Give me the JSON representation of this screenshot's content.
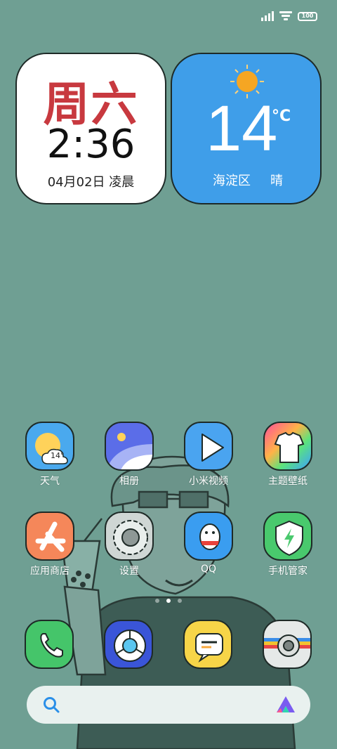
{
  "status_bar": {
    "battery": "100"
  },
  "clock_widget": {
    "day": "周六",
    "time": "2:36",
    "date": "04月02日 凌晨"
  },
  "weather_widget": {
    "temperature": "14",
    "unit": "°C",
    "location": "海淀区",
    "condition": "晴"
  },
  "apps_row1": [
    {
      "label": "天气",
      "badge": "14°"
    },
    {
      "label": "相册"
    },
    {
      "label": "小米视频"
    },
    {
      "label": "主题壁纸"
    }
  ],
  "apps_row2": [
    {
      "label": "应用商店"
    },
    {
      "label": "设置"
    },
    {
      "label": "QQ"
    },
    {
      "label": "手机管家"
    }
  ],
  "pager": {
    "pages": 3,
    "active": 2
  },
  "dock": [
    "phone",
    "browser",
    "messages",
    "camera"
  ],
  "colors": {
    "background": "#6f9f93",
    "weather_bg": "#3f9ee9",
    "clock_day": "#c8393f"
  }
}
